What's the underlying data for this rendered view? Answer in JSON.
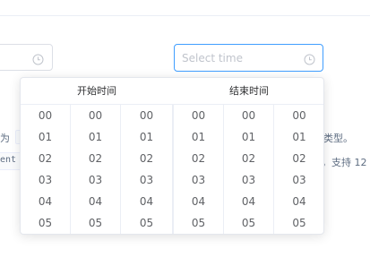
{
  "inputs": {
    "start_input_placeholder": "",
    "end_input_placeholder": "Select time"
  },
  "background": {
    "line1_prefix": "为",
    "line1_suffix": "类型。",
    "line2_code": "ent",
    "line2_suffix": "，支持 12"
  },
  "picker": {
    "start_title": "开始时间",
    "end_title": "结束时间",
    "values": [
      "00",
      "01",
      "02",
      "03",
      "04",
      "05"
    ]
  },
  "colors": {
    "focus_border": "#409eff",
    "border": "#dcdfe6",
    "text": "#606266"
  },
  "icons": {
    "input_suffix": "clock-icon"
  }
}
